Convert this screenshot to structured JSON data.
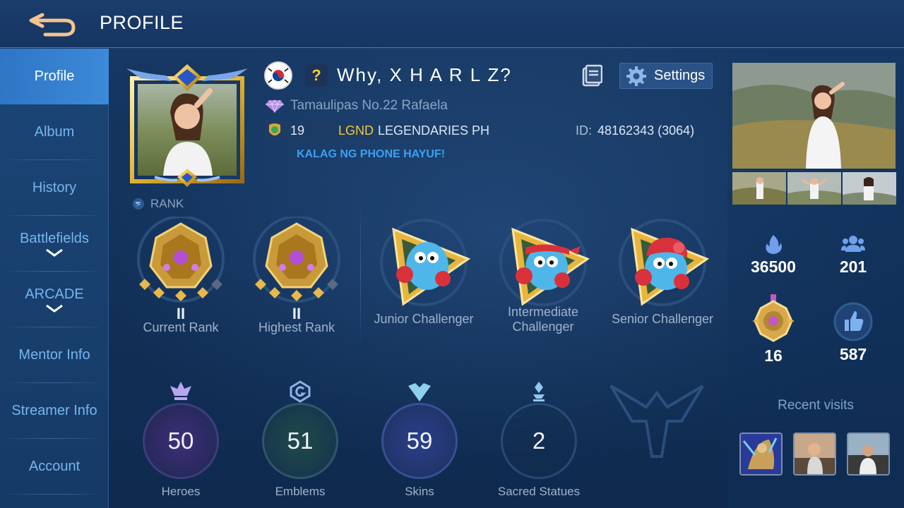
{
  "header": {
    "title": "PROFILE"
  },
  "sidebar": {
    "items": [
      {
        "label": "Profile",
        "active": true
      },
      {
        "label": "Album"
      },
      {
        "label": "History"
      },
      {
        "label": "Battlefields",
        "has_chevron": true
      },
      {
        "label": "ARCADE",
        "has_chevron": true
      },
      {
        "label": "Mentor Info"
      },
      {
        "label": "Streamer Info"
      },
      {
        "label": "Account"
      }
    ]
  },
  "player": {
    "name": "Why, X H A R L Z?",
    "q_badge": "?",
    "location": "Tamaulipas No.22 Rafaela",
    "squad_level": "19",
    "squad_tag": "LGND",
    "squad_name": "LEGENDARIES PH",
    "id_label": "ID:",
    "id_value": "48162343 (3064)",
    "bio": "KALAG NG PHONE HAYUF!",
    "settings_label": "Settings"
  },
  "ranks": {
    "label": "RANK",
    "items": [
      {
        "tier": "II",
        "caption": "Current Rank"
      },
      {
        "tier": "II",
        "caption": "Highest Rank"
      },
      {
        "caption": "Junior Challenger"
      },
      {
        "caption": "Intermediate Challenger"
      },
      {
        "caption": "Senior Challenger"
      }
    ]
  },
  "stats": [
    {
      "value": "50",
      "caption": "Heroes"
    },
    {
      "value": "51",
      "caption": "Emblems"
    },
    {
      "value": "59",
      "caption": "Skins"
    },
    {
      "value": "2",
      "caption": "Sacred Statues"
    }
  ],
  "right": {
    "popularity": "36500",
    "followers": "201",
    "medals": "16",
    "likes": "587",
    "recent_label": "Recent visits"
  },
  "colors": {
    "accent": "#3aa0f0",
    "gold": "#f0c845",
    "panel": "#163563"
  }
}
